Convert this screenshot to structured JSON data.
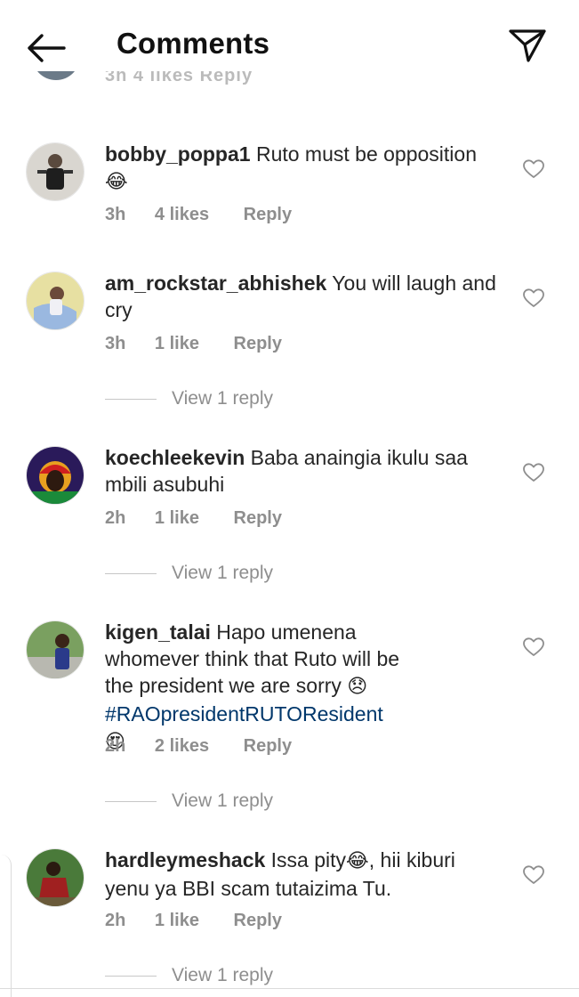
{
  "header": {
    "title": "Comments"
  },
  "partial": {
    "meta": "3h  4 likes  Reply"
  },
  "comments": [
    {
      "username": "bobby_poppa1",
      "text": "Ruto must be opposition",
      "emoji": "😂",
      "time": "3h",
      "likes": "4 likes",
      "reply": "Reply"
    },
    {
      "username": "am_rockstar_abhishek",
      "text": "You will laugh and cry",
      "time": "3h",
      "likes": "1 like",
      "reply": "Reply",
      "view_replies": "View 1 reply"
    },
    {
      "username": "koechleekevin",
      "text": "Baba anaingia ikulu saa mbili asubuhi",
      "time": "2h",
      "likes": "1 like",
      "reply": "Reply",
      "view_replies": "View 1 reply"
    },
    {
      "username": "kigen_talai",
      "text": "Hapo umenena whomever think that Ruto will be the president we are sorry",
      "emoji": "😞",
      "hashtag": "#RAOpresidentRUTOResident",
      "emoji2": "😍",
      "time": "2h",
      "likes": "2 likes",
      "reply": "Reply",
      "view_replies": "View 1 reply"
    },
    {
      "username": "hardleymeshack",
      "text": "Issa pity",
      "emoji": "😂",
      "text2": ", hii kiburi yenu ya BBI scam tutaizima Tu.",
      "time": "2h",
      "likes": "1 like",
      "reply": "Reply",
      "view_replies": "View 1 reply"
    }
  ]
}
